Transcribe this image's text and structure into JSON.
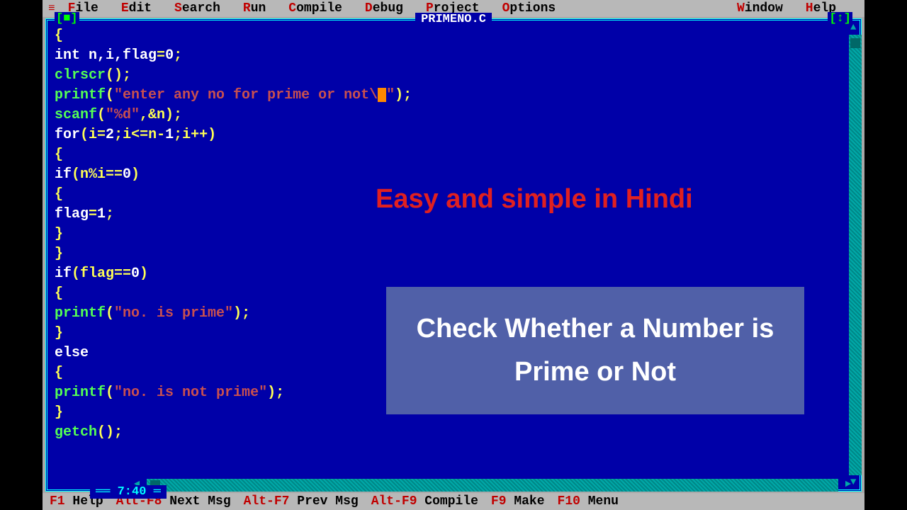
{
  "menu": {
    "items": [
      {
        "hotkey": "F",
        "rest": "ile"
      },
      {
        "hotkey": "E",
        "rest": "dit"
      },
      {
        "hotkey": "S",
        "rest": "earch"
      },
      {
        "hotkey": "R",
        "rest": "un"
      },
      {
        "hotkey": "C",
        "rest": "ompile"
      },
      {
        "hotkey": "D",
        "rest": "ebug"
      },
      {
        "hotkey": "P",
        "rest": "roject"
      },
      {
        "hotkey": "O",
        "rest": "ptions"
      },
      {
        "hotkey": "W",
        "rest": "indow"
      },
      {
        "hotkey": "H",
        "rest": "elp"
      }
    ]
  },
  "window": {
    "title": "PRIMENO.C",
    "close": "[■]",
    "zoom": "[↕]",
    "cursor_pos": "7:40"
  },
  "code": {
    "lines": [
      [
        {
          "t": "{",
          "c": "sym"
        }
      ],
      [
        {
          "t": "int",
          "c": "kw"
        },
        {
          "t": " n,i,flag",
          "c": "kw"
        },
        {
          "t": "=",
          "c": "sym"
        },
        {
          "t": "0",
          "c": "kw"
        },
        {
          "t": ";",
          "c": "sym"
        }
      ],
      [
        {
          "t": "clrscr",
          "c": "fn"
        },
        {
          "t": "();",
          "c": "sym"
        }
      ],
      [
        {
          "t": "printf",
          "c": "fn"
        },
        {
          "t": "(",
          "c": "sym"
        },
        {
          "t": "\"enter any no for prime or not\\",
          "c": "str"
        },
        {
          "t": "CURSOR",
          "c": "cursor"
        },
        {
          "t": "\"",
          "c": "str"
        },
        {
          "t": ");",
          "c": "sym"
        }
      ],
      [
        {
          "t": "scanf",
          "c": "fn"
        },
        {
          "t": "(",
          "c": "sym"
        },
        {
          "t": "\"%d\"",
          "c": "str"
        },
        {
          "t": ",&n);",
          "c": "sym"
        }
      ],
      [
        {
          "t": "for",
          "c": "kw"
        },
        {
          "t": "(i",
          "c": "sym"
        },
        {
          "t": "=",
          "c": "sym"
        },
        {
          "t": "2",
          "c": "kw"
        },
        {
          "t": ";i<=n-",
          "c": "sym"
        },
        {
          "t": "1",
          "c": "kw"
        },
        {
          "t": ";i++)",
          "c": "sym"
        }
      ],
      [
        {
          "t": "{",
          "c": "sym"
        }
      ],
      [
        {
          "t": "if",
          "c": "kw"
        },
        {
          "t": "(n%i==",
          "c": "sym"
        },
        {
          "t": "0",
          "c": "kw"
        },
        {
          "t": ")",
          "c": "sym"
        }
      ],
      [
        {
          "t": "{",
          "c": "sym"
        }
      ],
      [
        {
          "t": "flag",
          "c": "kw"
        },
        {
          "t": "=",
          "c": "sym"
        },
        {
          "t": "1",
          "c": "kw"
        },
        {
          "t": ";",
          "c": "sym"
        }
      ],
      [
        {
          "t": "}",
          "c": "sym"
        }
      ],
      [
        {
          "t": "}",
          "c": "sym"
        }
      ],
      [
        {
          "t": "if",
          "c": "kw"
        },
        {
          "t": "(flag==",
          "c": "sym"
        },
        {
          "t": "0",
          "c": "kw"
        },
        {
          "t": ")",
          "c": "sym"
        }
      ],
      [
        {
          "t": "{",
          "c": "sym"
        }
      ],
      [
        {
          "t": "printf",
          "c": "fn"
        },
        {
          "t": "(",
          "c": "sym"
        },
        {
          "t": "\"no. is prime\"",
          "c": "str"
        },
        {
          "t": ");",
          "c": "sym"
        }
      ],
      [
        {
          "t": "}",
          "c": "sym"
        }
      ],
      [
        {
          "t": "else",
          "c": "kw"
        }
      ],
      [
        {
          "t": "{",
          "c": "sym"
        }
      ],
      [
        {
          "t": "printf",
          "c": "fn"
        },
        {
          "t": "(",
          "c": "sym"
        },
        {
          "t": "\"no. is not prime\"",
          "c": "str"
        },
        {
          "t": ");",
          "c": "sym"
        }
      ],
      [
        {
          "t": "}",
          "c": "sym"
        }
      ],
      [
        {
          "t": "getch",
          "c": "fn"
        },
        {
          "t": "();",
          "c": "sym"
        }
      ]
    ]
  },
  "status": {
    "items": [
      {
        "key": "F1",
        "label": " Help"
      },
      {
        "key": "Alt-F8",
        "label": " Next Msg"
      },
      {
        "key": "Alt-F7",
        "label": " Prev Msg"
      },
      {
        "key": "Alt-F9",
        "label": " Compile"
      },
      {
        "key": "F9",
        "label": " Make"
      },
      {
        "key": "F10",
        "label": " Menu"
      }
    ]
  },
  "overlay": {
    "text1": "Easy and simple in Hindi",
    "box_line1": "Check Whether a Number is",
    "box_line2": "Prime or Not"
  }
}
